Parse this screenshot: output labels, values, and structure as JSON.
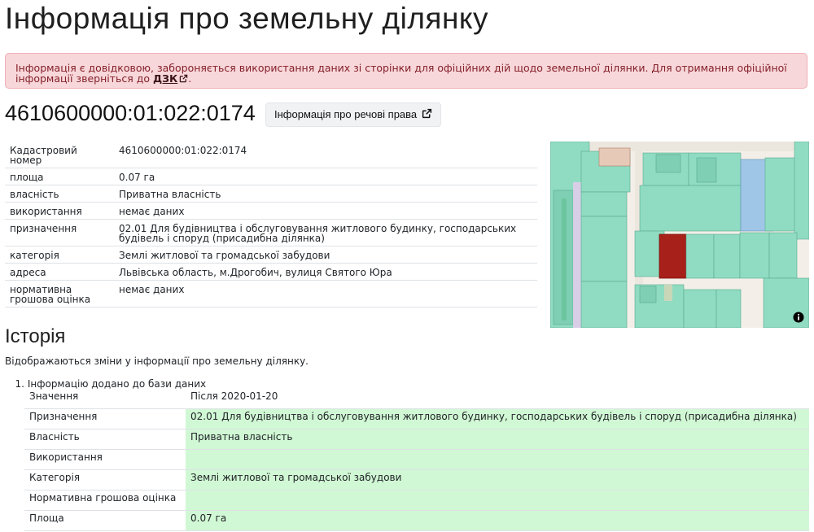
{
  "page": {
    "title": "Інформація про земельну ділянку"
  },
  "alert": {
    "text": "Інформація є довідковою, забороняється використання даних зі сторінки для офіційних дій щодо земельної ділянки. Для отримання офіційної інформації зверніться до ",
    "link_label": "ДЗК",
    "tail": "."
  },
  "parcel": {
    "cadastral_title": "4610600000:01:022:0174",
    "rights_button_label": "Інформація про речові права"
  },
  "properties": [
    {
      "key": "Кадастровий номер",
      "value": "4610600000:01:022:0174"
    },
    {
      "key": "площа",
      "value": "0.07 га"
    },
    {
      "key": "власність",
      "value": "Приватна власність"
    },
    {
      "key": "використання",
      "value": "немає даних"
    },
    {
      "key": "призначення",
      "value": "02.01 Для будівництва і обслуговування житлового будинку, господарських будівель і споруд (присадибна ділянка)"
    },
    {
      "key": "категорія",
      "value": "Землі житлової та громадської забудови"
    },
    {
      "key": "адреса",
      "value": "Львівська область, м.Дрогобич, вулиця Святого Юра"
    },
    {
      "key": "нормативна грошова оцінка",
      "value": "немає даних"
    }
  ],
  "map": {
    "icon": "info-icon",
    "colors": {
      "parcel": "#a8201a",
      "neighbors": "#7dd3b8",
      "background": "#f3efe8"
    }
  },
  "history": {
    "heading": "Історія",
    "description": "Відображаються зміни у інформації про земельну ділянку.",
    "entries": [
      {
        "number": "1.",
        "title": "Інформацію додано до бази даних",
        "header": {
          "key": "Значення",
          "value": "Після 2020-01-20"
        },
        "rows": [
          {
            "key": "Призначення",
            "value": "02.01 Для будівництва і обслуговування житлового будинку, господарських будівель і споруд (присадибна ділянка)"
          },
          {
            "key": "Власність",
            "value": "Приватна власність"
          },
          {
            "key": "Використання",
            "value": ""
          },
          {
            "key": "Категорія",
            "value": "Землі житлової та громадської забудови"
          },
          {
            "key": "Нормативна грошова оцінка",
            "value": ""
          },
          {
            "key": "Площа",
            "value": "0.07 га"
          }
        ]
      }
    ]
  }
}
